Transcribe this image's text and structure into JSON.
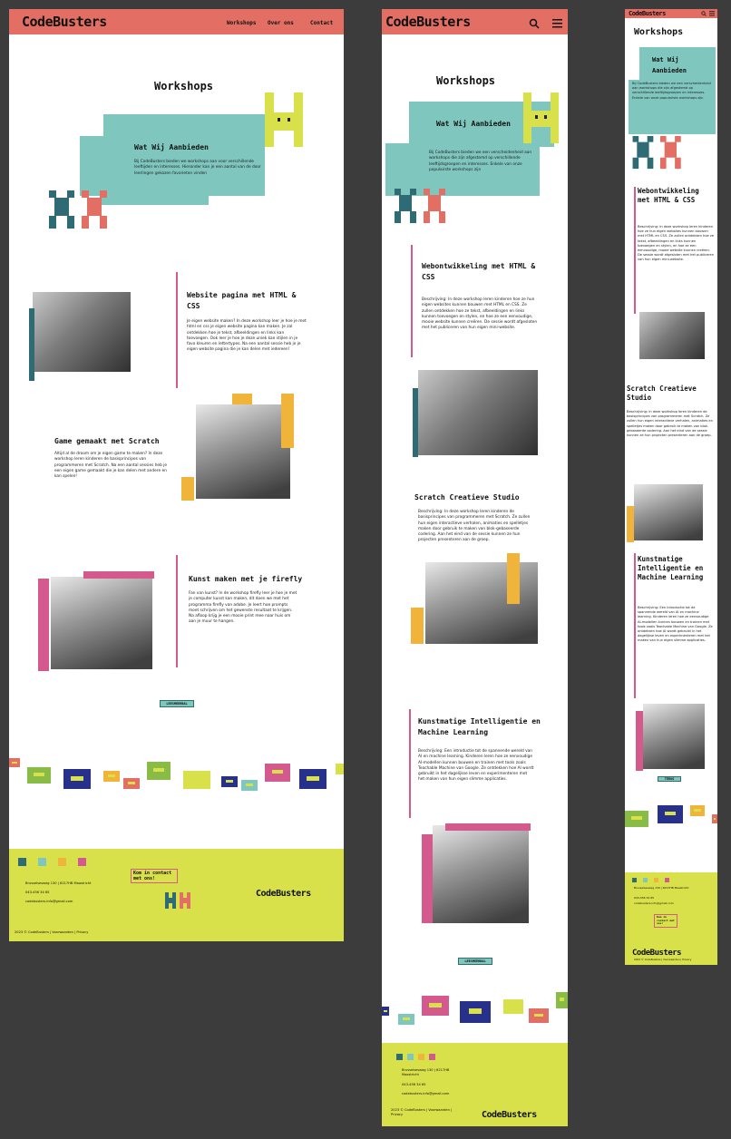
{
  "brand": {
    "name": "CodeBusters",
    "footer_name": "CodeBusters"
  },
  "nav": {
    "items": [
      "Workshops",
      "Over ons",
      "Contact"
    ]
  },
  "hero": {
    "title": "Workshops",
    "subtitle": "Wat Wij Aanbieden",
    "intro": "Bij CodeBusters bieden we workshops aan voor verschillende leeftijden en interesses. Hieronder kan je een aantal van de door leerlingen gekozen favorieten vinden",
    "intro_tablet": "Bij CodeBusters bieden we een verscheidenheid aan workshops die zijn afgestemd op verschillende leeftijdsgroepen en interesses. Enkele van onze populairste workshops zijn"
  },
  "workshops": [
    {
      "title": "Website pagina met HTML & CSS",
      "title_tablet": "Webontwikkeling met HTML & CSS",
      "desc": "Je eigen website maken? In deze workshop leer je hoe je met html en css je eigen website pagina kan maken. Je zal ontdekken hoe je tekst, afbeeldingen en links kan toevoegen. Ook leer je hoe je deze uniek kan stijlen in je favo kleuren en lettertypes. Na een aantal sessie heb je je eigen website pagina die je kan delen met iedereen!",
      "desc_tablet": "Beschrijving: In deze workshop leren kinderen hoe ze hun eigen websites kunnen bouwen met HTML en CSS. Ze zullen ontdekken hoe ze tekst, afbeeldingen en links kunnen toevoegen en stylen, en hoe ze een eenvoudige, mooie website kunnen creëren. De sessie wordt afgesloten met het publiceren van hun eigen mini-website."
    },
    {
      "title": "Game gemaakt met Scratch",
      "title_tablet": "Scratch Creatieve Studio",
      "desc": "Altijd al de droom om je eigen game te maken? In deze workshop leren kinderen de basisprincipes van programmeren met Scratch. Na een aantal sessies heb je een eigen game gemaakt die je kan delen met andere en kan spelen!",
      "desc_tablet": "Beschrijving: In deze workshop leren kinderen de basisprincipes van programmeren met Scratch. Ze zullen hun eigen interactieve verhalen, animaties en spelletjes maken door gebruik te maken van blok-gebaseerde codering. Aan het eind van de sessie kunnen ze hun projecten presenteren aan de groep."
    },
    {
      "title": "Kunst maken met je firefly",
      "title_tablet": "Kunstmatige Intelligentie en Machine Learning",
      "desc": "Fan van kunst? In de workshop firefly leer je hoe je met je computer kunst kan maken, dit doen we met het programma firefly van adobe. Je leert hoe prompts moet schrijven om het gewenste resultaat te krijgen. Na afloop krijg je een mooie print mee naar huis om aan je muur te hangen.",
      "desc_tablet": "Beschrijving: Een introductie tot de spannende wereld van AI en machine learning. Kinderen leren hoe ze eenvoudige AI-modellen kunnen bouwen en trainen met tools zoals Teachable Machine van Google. Ze ontdekken hoe AI wordt gebruikt in het dagelijkse leven en experimenteren met het maken van hun eigen slimme applicaties."
    }
  ],
  "cta": {
    "label": "LEESMEERBAL",
    "label_mobile": "TERUG"
  },
  "footer": {
    "address": "Brusselsesweg 130 | 6217HB Maastricht",
    "phone": "043-456 34 65",
    "email": "codebusters.info@gmail.com",
    "copyright": "2023 © CodeBusters | Voorwaarden | Privacy",
    "contact": "Kom in contact met ons!"
  },
  "colors": {
    "header": "#e36e63",
    "teal": "#7fc6bf",
    "yellow": "#d8e04a",
    "pink": "#d45a8e",
    "orange": "#f0b43a",
    "navy": "#27308a",
    "bg": "#3c3c3c"
  },
  "icons": [
    "search-icon",
    "menu-icon",
    "linkedin-icon",
    "facebook-icon",
    "instagram-icon",
    "youtube-icon",
    "home-icon",
    "phone-icon",
    "mail-icon"
  ]
}
